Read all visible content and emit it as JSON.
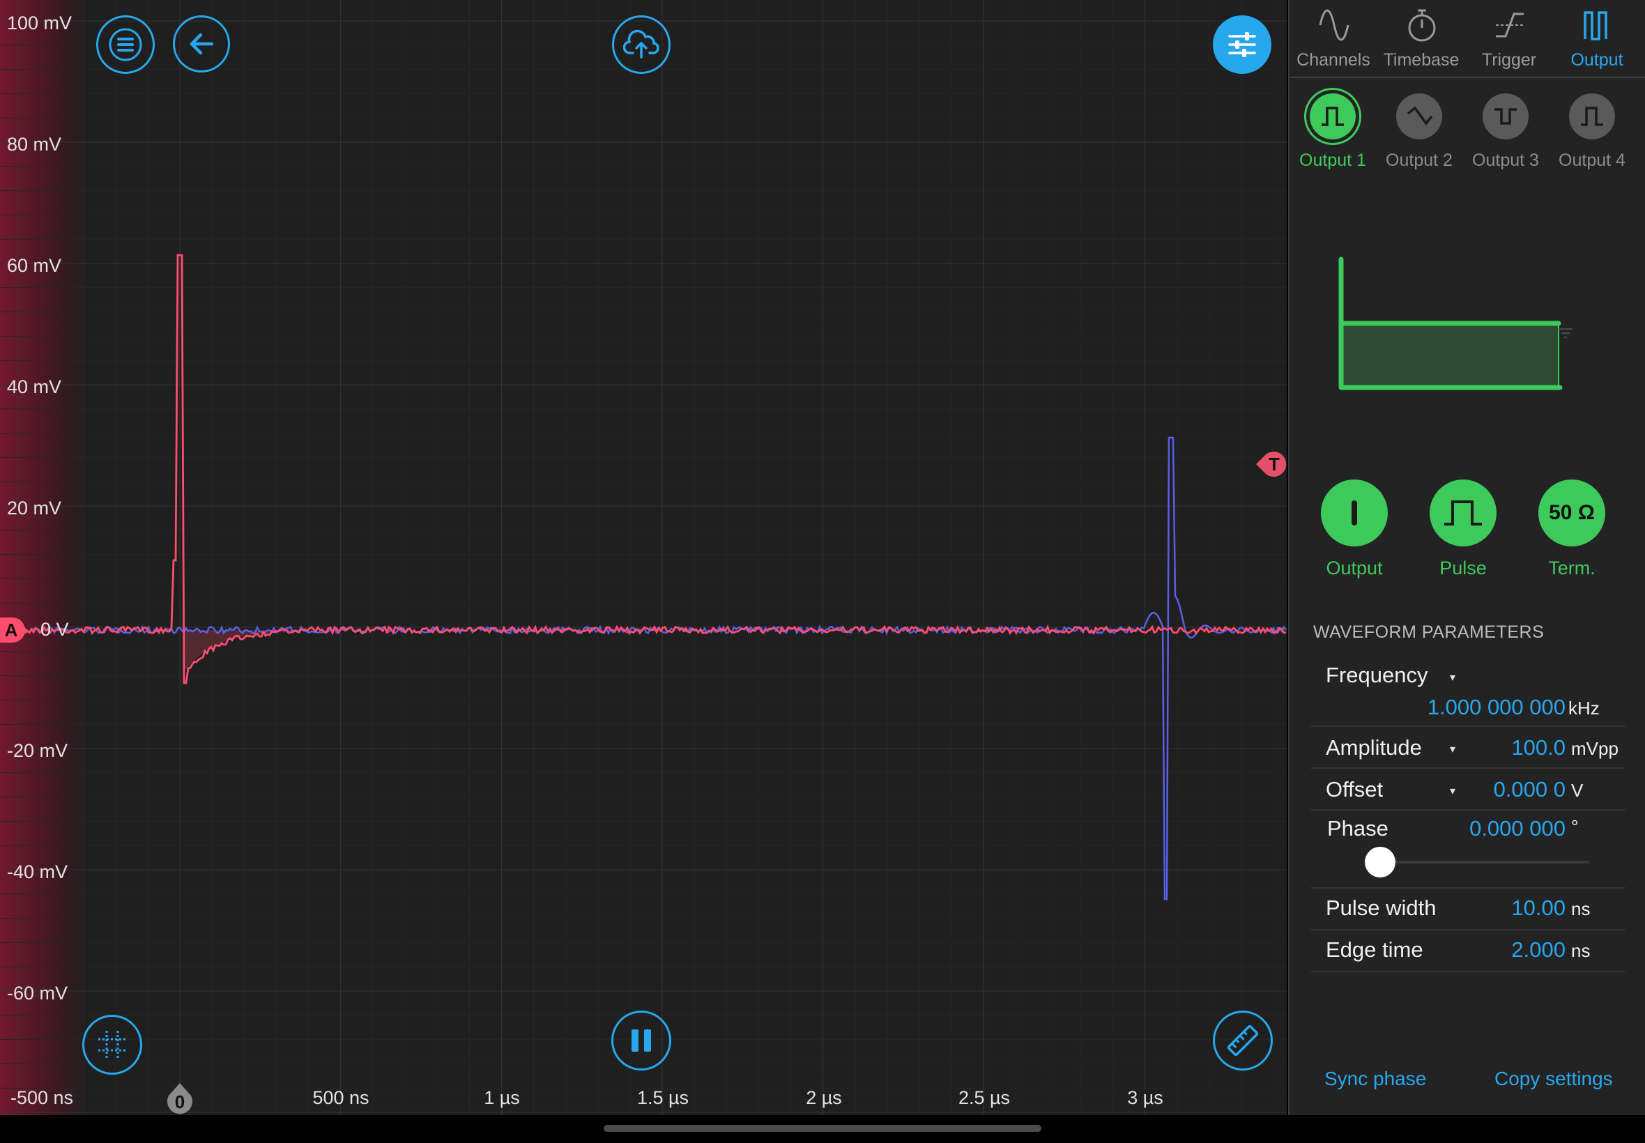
{
  "plot": {
    "y_labels": [
      "100 mV",
      "80 mV",
      "60 mV",
      "40 mV",
      "20 mV",
      "0 V",
      "-20 mV",
      "-40 mV",
      "-60 mV"
    ],
    "x_labels": [
      "-500 ns",
      "0",
      "500 ns",
      "1 µs",
      "1.5 µs",
      "2 µs",
      "2.5 µs",
      "3 µs"
    ],
    "channel_marker": "A",
    "trigger_marker": "T",
    "trace_colors": {
      "channel_a": "#ff4d6d",
      "channel_b": "#5a5fe6"
    },
    "accent": "#27a8ee"
  },
  "toolbar": {
    "menu_icon": "hamburger-icon",
    "back_icon": "arrow-left-icon",
    "upload_icon": "cloud-upload-icon",
    "settings_icon": "sliders-icon",
    "grid_icon": "grid-icon",
    "pause_icon": "pause-icon",
    "measure_icon": "ruler-icon"
  },
  "panel": {
    "tabs": [
      {
        "label": "Channels",
        "icon": "sine-icon"
      },
      {
        "label": "Timebase",
        "icon": "stopwatch-icon"
      },
      {
        "label": "Trigger",
        "icon": "trigger-edge-icon"
      },
      {
        "label": "Output",
        "icon": "pulse-output-icon",
        "active": true
      }
    ],
    "outputs": [
      {
        "label": "Output 1",
        "active": true
      },
      {
        "label": "Output 2"
      },
      {
        "label": "Output 3"
      },
      {
        "label": "Output 4"
      }
    ],
    "controls": [
      {
        "label": "Output",
        "icon": "power-icon"
      },
      {
        "label": "Pulse",
        "icon": "pulse-icon"
      },
      {
        "label": "Term.",
        "icon_text": "50 Ω"
      }
    ],
    "section_title": "WAVEFORM PARAMETERS",
    "params": {
      "frequency": {
        "label": "Frequency",
        "value": "1.000 000 000",
        "unit": "kHz"
      },
      "amplitude": {
        "label": "Amplitude",
        "value": "100.0",
        "unit": "mVpp"
      },
      "offset": {
        "label": "Offset",
        "value": "0.000 0",
        "unit": "V"
      },
      "phase": {
        "label": "Phase",
        "value": "0.000 000",
        "unit": "°",
        "slider_level": 0
      },
      "pulse_width": {
        "label": "Pulse width",
        "value": "10.00",
        "unit": "ns"
      },
      "edge_time": {
        "label": "Edge time",
        "value": "2.000",
        "unit": "ns"
      }
    },
    "sync_phase": "Sync phase",
    "copy_settings": "Copy settings",
    "green": "#3ec95b"
  }
}
